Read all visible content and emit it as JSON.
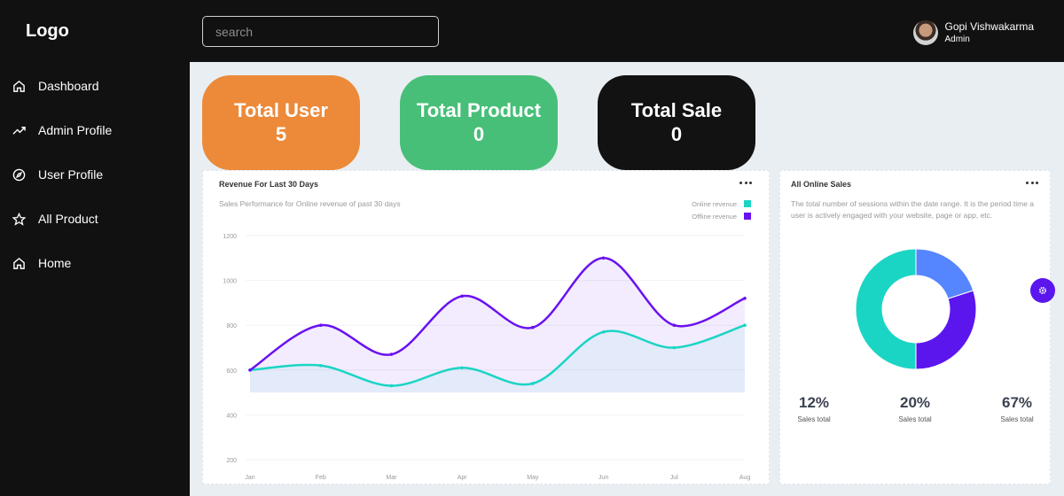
{
  "header": {
    "logo": "Logo",
    "search_placeholder": "search",
    "user_name": "Gopi Vishwakarma",
    "user_role": "Admin"
  },
  "sidebar": {
    "items": [
      {
        "label": "Dashboard",
        "icon": "home-icon"
      },
      {
        "label": "Admin Profile",
        "icon": "trending-up-icon"
      },
      {
        "label": "User Profile",
        "icon": "compass-icon"
      },
      {
        "label": "All Product",
        "icon": "star-icon"
      },
      {
        "label": "Home",
        "icon": "home-icon"
      }
    ]
  },
  "cards": [
    {
      "title": "Total User",
      "value": "5",
      "color": "#ec8a39"
    },
    {
      "title": "Total Product",
      "value": "0",
      "color": "#48bf78"
    },
    {
      "title": "Total Sale",
      "value": "0",
      "color": "#121212"
    }
  ],
  "revenue_panel": {
    "title": "Revenue For Last 30 Days",
    "subtitle": "Sales Performance for Online revenue of past 30 days"
  },
  "sales_panel": {
    "title": "All Online Sales",
    "description": "The total number of sessions within the date range. It is the period time a user is actively engaged with your website, page or app, etc.",
    "stats": [
      {
        "value": "12%",
        "label": "Sales total"
      },
      {
        "value": "20%",
        "label": "Sales total"
      },
      {
        "value": "67%",
        "label": "Sales total"
      }
    ]
  },
  "chart_data": [
    {
      "type": "line",
      "title": "Revenue For Last 30 Days",
      "categories": [
        "Jan",
        "Feb",
        "Mar",
        "Apr",
        "May",
        "Jun",
        "Jul",
        "Aug"
      ],
      "ylim": [
        200,
        1200
      ],
      "yticks": [
        200,
        400,
        600,
        800,
        1000,
        1200
      ],
      "grid": true,
      "legend": "top-right",
      "series": [
        {
          "name": "Online revenue",
          "color": "#1ad5c4",
          "values": [
            600,
            620,
            530,
            610,
            540,
            770,
            700,
            800
          ]
        },
        {
          "name": "Offline revenue",
          "color": "#6a11f0",
          "values": [
            600,
            800,
            670,
            930,
            790,
            1100,
            800,
            920
          ]
        }
      ]
    },
    {
      "type": "pie",
      "title": "All Online Sales",
      "labels": [],
      "values": [
        20,
        30,
        50
      ],
      "colors": [
        "#5585ff",
        "#5b16ee",
        "#1ad5c4"
      ]
    }
  ]
}
